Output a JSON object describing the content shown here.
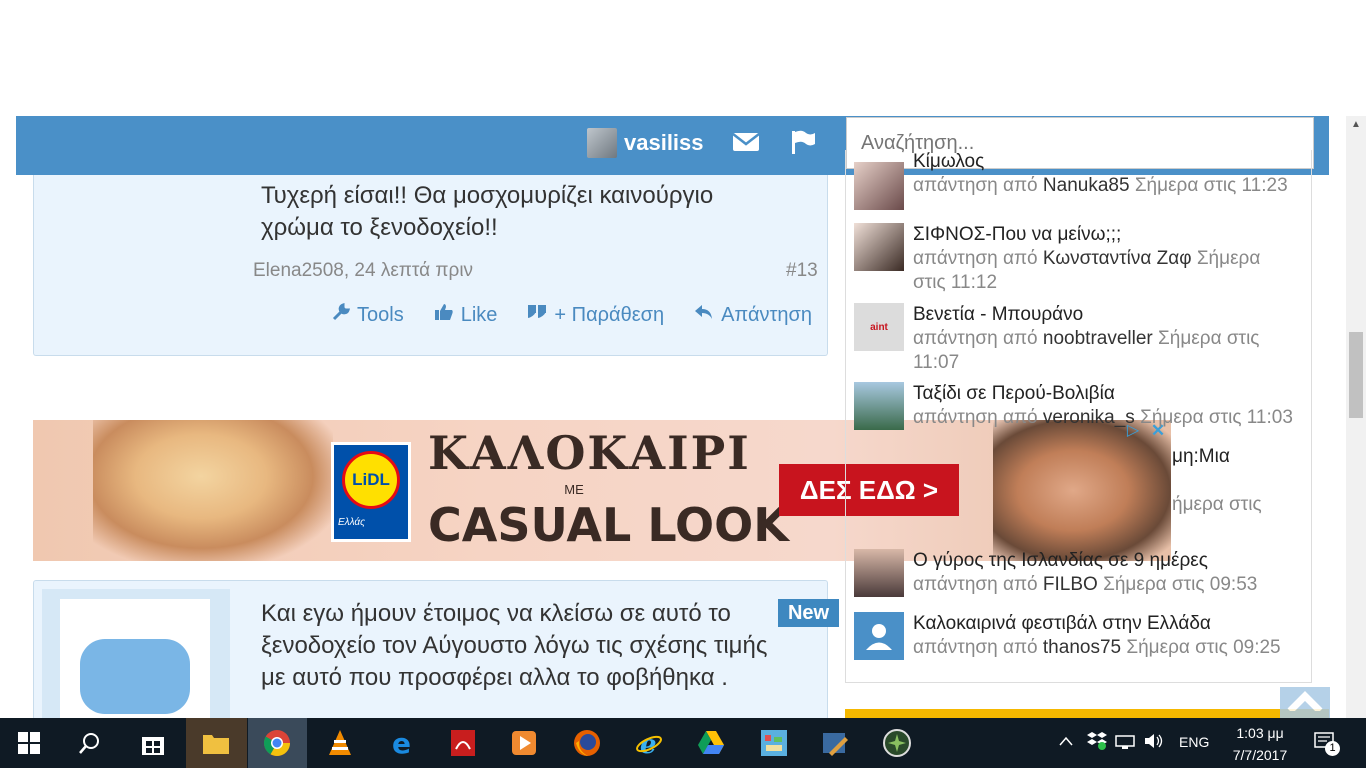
{
  "header": {
    "username": "vasiliss",
    "search_placeholder": "Αναζήτηση..."
  },
  "posts": [
    {
      "text": "Τυχερή είσαι!! Θα μοσχομυρίζει καινούργιο χρώμα το ξενοδοχείο!!",
      "author_time": "Elena2508, 24 λεπτά πριν",
      "number": "#13",
      "actions": {
        "tools": "Tools",
        "like": "Like",
        "quote": "+ Παράθεση",
        "reply": "Απάντηση"
      }
    },
    {
      "badge": "New",
      "text": "Και εγω ήμουν έτοιμος να κλείσω σε αυτό το ξενοδοχείο τον Αύγουστο λόγω τις σχέσης τιμής με αυτό που προσφέρει αλλα το φοβήθηκα ."
    }
  ],
  "ad": {
    "brand": "LiDL",
    "brand_sub": "Ελλάς",
    "line1": "ΚΑΛΟΚΑΙΡΙ",
    "line2": "ΜΕ",
    "line3": "CASUAL LOOK",
    "cta": "ΔΕΣ ΕΔΩ >",
    "ad_choice": "▷",
    "close": "✕"
  },
  "sidebar": {
    "items": [
      {
        "title": "Κίμωλος",
        "prefix": "απάντηση από",
        "user": "Nanuka85",
        "time": "Σήμερα στις 11:23"
      },
      {
        "title": "ΣΙΦΝΟΣ-Που να μείνω;;;",
        "prefix": "απάντηση από",
        "user": "Κωνσταντίνα Ζαφ",
        "time": "Σήμερα στις 11:12"
      },
      {
        "title": "Βενετία - Μπουράνο",
        "prefix": "απάντηση από",
        "user": "noobtraveller",
        "time": "Σήμερα στις 11:07",
        "thumb_text": "aint"
      },
      {
        "title": "Ταξίδι σε Περού-Βολιβία",
        "prefix": "απάντηση από",
        "user": "veronika_s",
        "time": "Σήμερα στις 11:03"
      },
      {
        "title_fragment": "μη:Μια",
        "time_fragment": "ήμερα στις"
      },
      {
        "title": "Ο γύρος της Ισλανδίας σε 9 ημέρες",
        "prefix": "απάντηση από",
        "user": "FILBO",
        "time": "Σήμερα στις 09:53"
      },
      {
        "title": "Καλοκαιρινά φεστιβάλ στην Ελλάδα",
        "prefix": "απάντηση από",
        "user": "thanos75",
        "time": "Σήμερα στις 09:25"
      }
    ]
  },
  "taskbar": {
    "lang": "ENG",
    "time": "1:03 μμ",
    "date": "7/7/2017",
    "notifications": "1"
  },
  "colors": {
    "header": "#4a90c8",
    "link": "#4a8ac0",
    "taskbar": "#0f1a24",
    "badge": "#3e88c0"
  }
}
